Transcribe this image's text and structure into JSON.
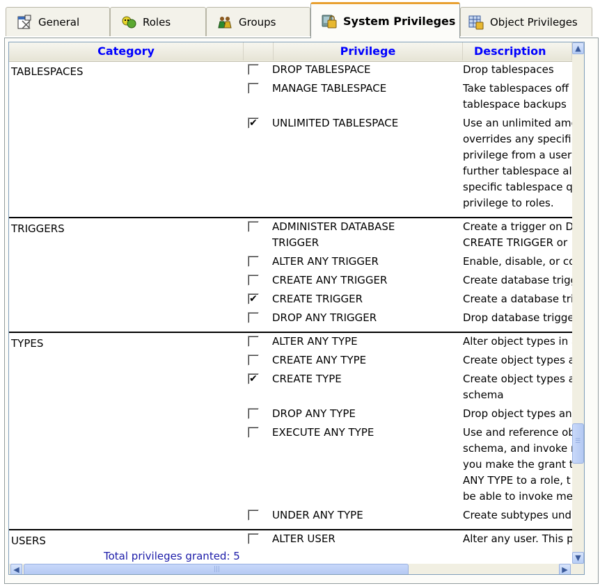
{
  "tabs": [
    {
      "label": "General",
      "icon": "properties-icon"
    },
    {
      "label": "Roles",
      "icon": "roles-icon"
    },
    {
      "label": "Groups",
      "icon": "groups-icon"
    },
    {
      "label": "System Privileges",
      "icon": "system-privileges-icon",
      "active": true
    },
    {
      "label": "Object Privileges",
      "icon": "object-privileges-icon"
    }
  ],
  "grid": {
    "columns": {
      "category": "Category",
      "privilege": "Privilege",
      "description": "Description"
    },
    "groups": [
      {
        "category": "TABLESPACES",
        "rows": [
          {
            "name": "DROP TABLESPACE",
            "checked": false,
            "desc": "Drop tablespaces"
          },
          {
            "name": "MANAGE TABLESPACE",
            "checked": false,
            "desc": "Take tablespaces off\ntablespace backups"
          },
          {
            "name": "UNLIMITED TABLESPACE",
            "checked": true,
            "desc": "Use an unlimited amou\noverrides any specifi\nprivilege from a user,\nfurther tablespace all\nspecific tablespace q\nprivilege to roles."
          }
        ]
      },
      {
        "category": "TRIGGERS",
        "rows": [
          {
            "name": "ADMINISTER DATABASE TRIGGER",
            "checked": false,
            "desc": "Create a trigger on DA\nCREATE TRIGGER or"
          },
          {
            "name": "ALTER ANY TRIGGER",
            "checked": false,
            "desc": "Enable, disable, or co"
          },
          {
            "name": "CREATE ANY TRIGGER",
            "checked": false,
            "desc": "Create database trigg"
          },
          {
            "name": "CREATE TRIGGER",
            "checked": true,
            "desc": "Create a database tri"
          },
          {
            "name": "DROP ANY TRIGGER",
            "checked": false,
            "desc": "Drop database trigger"
          }
        ]
      },
      {
        "category": "TYPES",
        "rows": [
          {
            "name": "ALTER ANY TYPE",
            "checked": false,
            "desc": "Alter object types in a"
          },
          {
            "name": "CREATE ANY TYPE",
            "checked": false,
            "desc": "Create object types a"
          },
          {
            "name": "CREATE TYPE",
            "checked": true,
            "desc": "Create object types a\nschema"
          },
          {
            "name": "DROP ANY TYPE",
            "checked": false,
            "desc": "Drop object types and"
          },
          {
            "name": "EXECUTE ANY TYPE",
            "checked": false,
            "desc": "Use and reference ob\nschema, and invoke m\nyou make the grant to\nANY TYPE to a role, t\nbe able to invoke meth"
          },
          {
            "name": "UNDER ANY TYPE",
            "checked": false,
            "desc": "Create subtypes unde"
          }
        ]
      },
      {
        "category": "USERS",
        "rows": [
          {
            "name": "ALTER USER",
            "checked": false,
            "desc": "Alter any user. This p"
          }
        ]
      }
    ],
    "footer": "Total privileges granted: 5",
    "check_mark": "✔"
  }
}
